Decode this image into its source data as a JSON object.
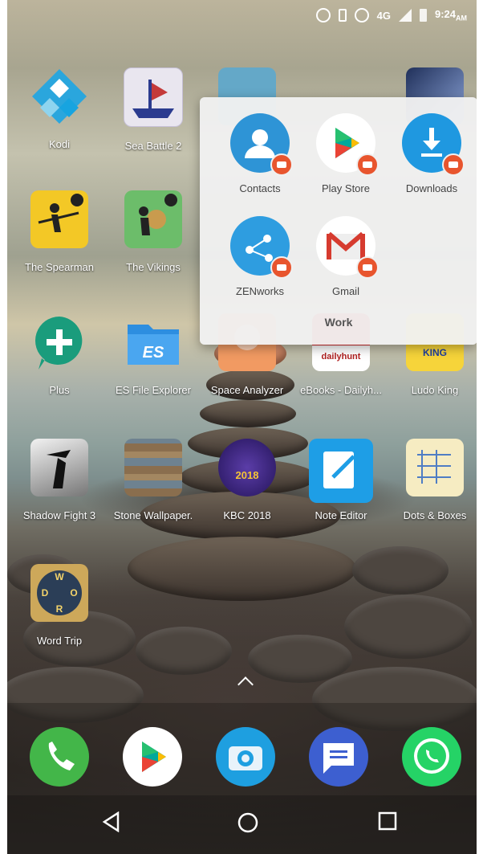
{
  "status_bar": {
    "network": "4G",
    "time": "9:24",
    "ampm": "AM"
  },
  "home": {
    "row1": [
      {
        "name": "kodi",
        "label": "Kodi"
      },
      {
        "name": "sea-battle",
        "label": "Sea Battle 2"
      },
      {
        "name": "bow-game",
        "label": ""
      },
      {
        "name": "anime-game",
        "label": ""
      }
    ],
    "row2": [
      {
        "name": "spearman",
        "label": "The Spearman"
      },
      {
        "name": "vikings",
        "label": "The Vikings"
      }
    ],
    "row3": [
      {
        "name": "plus",
        "label": "Plus"
      },
      {
        "name": "es-file-explorer",
        "label": "ES File Explorer"
      },
      {
        "name": "space-analyzer",
        "label": "Space Analyzer"
      },
      {
        "name": "ebooks",
        "label": "eBooks - Dailyh..."
      },
      {
        "name": "ludo-king",
        "label": "Ludo King"
      }
    ],
    "row4": [
      {
        "name": "shadow-fight",
        "label": "Shadow Fight 3"
      },
      {
        "name": "stone-wallpaper",
        "label": "Stone Wallpaper."
      },
      {
        "name": "kbc-2018",
        "label": "KBC 2018",
        "badge_text": "2018"
      },
      {
        "name": "note-editor",
        "label": "Note Editor"
      },
      {
        "name": "dots-boxes",
        "label": "Dots & Boxes"
      }
    ],
    "row5": [
      {
        "name": "word-trip",
        "label": "Word Trip",
        "letters": [
          "W",
          "D",
          "O",
          "R"
        ]
      }
    ]
  },
  "folder": {
    "name": "Work",
    "apps": [
      {
        "label": "Contacts"
      },
      {
        "label": "Play Store"
      },
      {
        "label": "Downloads"
      },
      {
        "label": "ZENworks"
      },
      {
        "label": "Gmail"
      }
    ]
  },
  "dock": [
    "Phone",
    "Play Store",
    "Camera",
    "Messages",
    "WhatsApp"
  ],
  "labels": {
    "dailyhunt": "dailyhunt",
    "ludo": "KING",
    "es": "ES"
  },
  "colors": {
    "badge": "#e8552e",
    "folder_bg": "#f0f0f0",
    "folder_text": "#444444"
  }
}
